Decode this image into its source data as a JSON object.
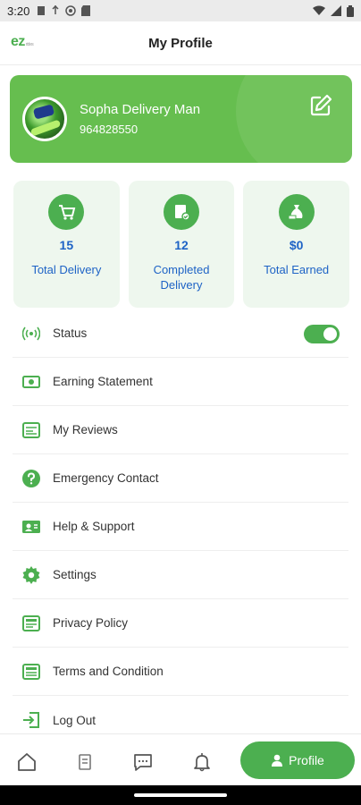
{
  "status_bar": {
    "time": "3:20",
    "left_icons": [
      "notification-icon",
      "usb-icon",
      "settings-dot-icon",
      "sd-card-icon"
    ],
    "right_icons": [
      "wifi-icon",
      "signal-icon",
      "battery-icon"
    ]
  },
  "app_bar": {
    "logo_text": "ez",
    "logo_sub": "rides",
    "title": "My Profile"
  },
  "profile": {
    "name": "Sopha Delivery Man",
    "phone": "964828550",
    "edit_icon": "edit-icon"
  },
  "stats": [
    {
      "value": "15",
      "label": "Total Delivery",
      "icon": "cart-icon"
    },
    {
      "value": "12",
      "label": "Completed Delivery",
      "icon": "box-check-icon"
    },
    {
      "value": "$0",
      "label": "Total Earned",
      "icon": "money-bag-icon"
    }
  ],
  "menu": {
    "status": {
      "label": "Status",
      "toggle_on": true
    },
    "items": [
      {
        "label": "Earning Statement",
        "icon": "money-icon"
      },
      {
        "label": "My Reviews",
        "icon": "review-icon"
      },
      {
        "label": "Emergency Contact",
        "icon": "help-icon"
      },
      {
        "label": "Help & Support",
        "icon": "contact-card-icon"
      },
      {
        "label": "Settings",
        "icon": "gear-icon"
      },
      {
        "label": "Privacy Policy",
        "icon": "document-icon"
      },
      {
        "label": "Terms and Condition",
        "icon": "terms-icon"
      },
      {
        "label": "Log Out",
        "icon": "logout-icon"
      }
    ]
  },
  "bottom_nav": {
    "items": [
      "home-icon",
      "orders-icon",
      "chat-icon",
      "bell-icon"
    ],
    "active_label": "Profile"
  },
  "colors": {
    "accent": "#4caf50",
    "card": "#66be4f",
    "stat_text": "#1e63c6",
    "stat_bg": "#eef7ee"
  }
}
